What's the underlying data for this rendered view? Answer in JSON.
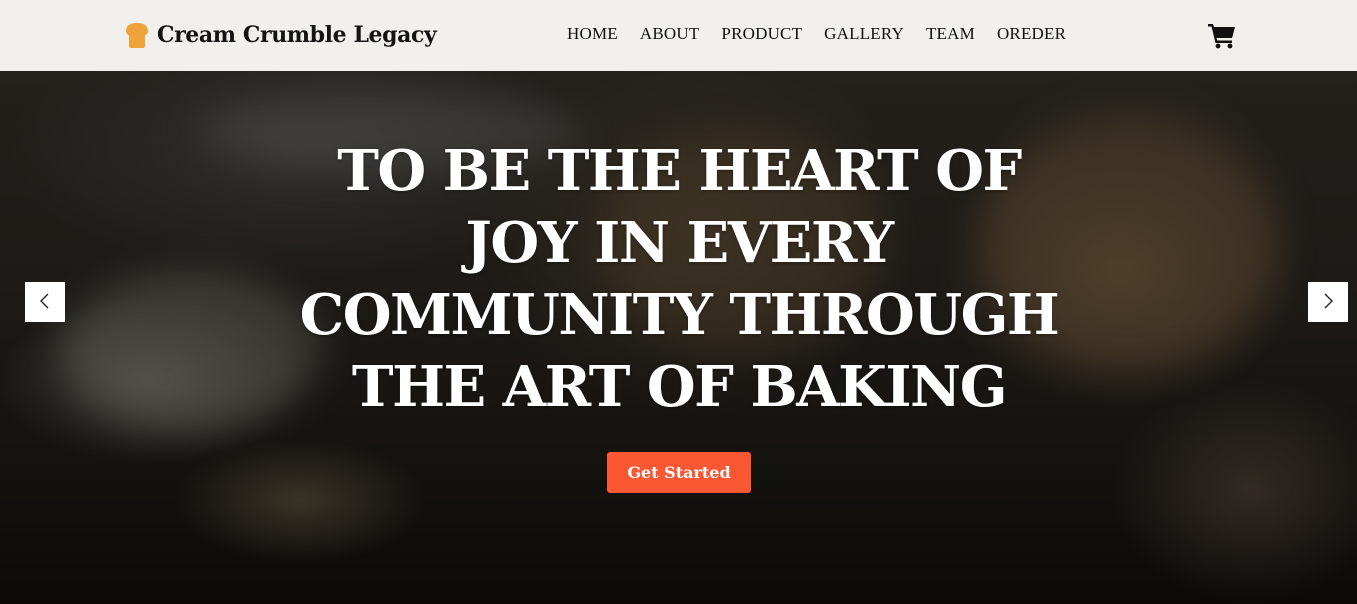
{
  "brand": {
    "name": "Cream Crumble Legacy",
    "icon": "bread-icon",
    "icon_color": "#f0a23a"
  },
  "nav": {
    "items": [
      {
        "label": "HOME"
      },
      {
        "label": "ABOUT"
      },
      {
        "label": "PRODUCT"
      },
      {
        "label": "GALLERY"
      },
      {
        "label": "TEAM"
      },
      {
        "label": "OREDER"
      }
    ]
  },
  "cart": {
    "icon": "shopping-cart-icon"
  },
  "hero": {
    "heading": "TO BE THE HEART OF JOY IN EVERY COMMUNITY THROUGH THE ART OF BAKING",
    "cta_label": "Get Started",
    "cta_color": "#fb5733",
    "prev_icon": "chevron-left-icon",
    "next_icon": "chevron-right-icon"
  },
  "colors": {
    "navbar_bg": "#f1f0ec",
    "text_dark": "#141414",
    "hero_text": "#ffffff"
  }
}
